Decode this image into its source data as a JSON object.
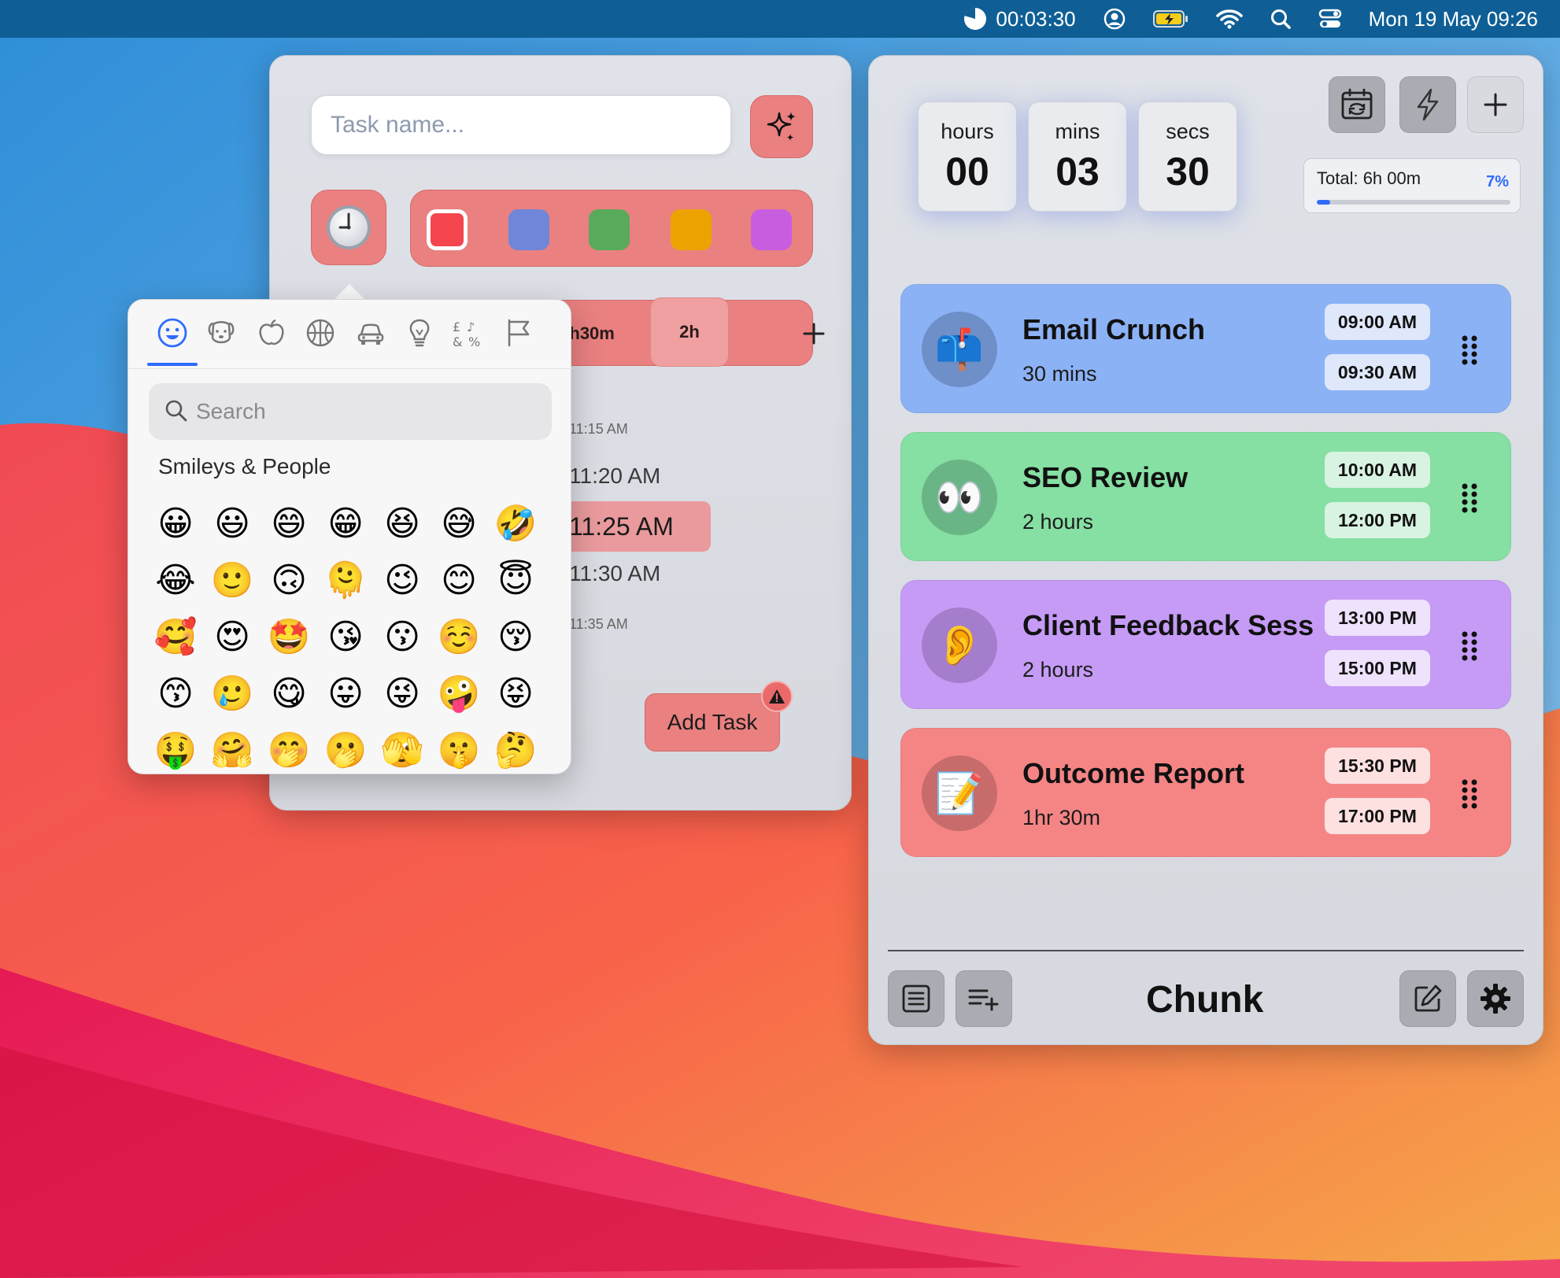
{
  "menubar": {
    "timer": "00:03:30",
    "datetime": "Mon 19 May  09:26",
    "icons": [
      "pie-timer-icon",
      "user-circle-icon",
      "battery-charging-icon",
      "wifi-icon",
      "spotlight-search-icon",
      "control-center-icon"
    ]
  },
  "task_form": {
    "task_name_placeholder": "Task name...",
    "colors": [
      {
        "hex": "#f4444e",
        "selected": true
      },
      {
        "hex": "#6f86d9",
        "selected": false
      },
      {
        "hex": "#5aaa5c",
        "selected": false
      },
      {
        "hex": "#eca300",
        "selected": false
      },
      {
        "hex": "#c75ee0",
        "selected": false
      }
    ],
    "durations": [
      "1h30m",
      "2h"
    ],
    "active_duration": "2h",
    "add_duration_label": "+",
    "times": [
      "11:15 AM",
      "11:20 AM",
      "11:25 AM",
      "11:30 AM",
      "11:35 AM"
    ],
    "selected_time": "11:25 AM",
    "add_task_label": "Add Task"
  },
  "emoji_picker": {
    "categories": [
      "smileys-icon",
      "animals-icon",
      "food-icon",
      "activity-icon",
      "travel-icon",
      "objects-icon",
      "symbols-icon",
      "flags-icon"
    ],
    "search_placeholder": "Search",
    "section_title": "Smileys & People",
    "emojis": [
      [
        "😀",
        "😃",
        "😄",
        "😁",
        "😆",
        "😅",
        "🤣"
      ],
      [
        "😂",
        "🙂",
        "🙃",
        "🫠",
        "😉",
        "😊",
        "😇"
      ],
      [
        "🥰",
        "😍",
        "🤩",
        "😘",
        "😗",
        "☺️",
        "😚"
      ],
      [
        "😙",
        "🥲",
        "😋",
        "😛",
        "😜",
        "🤪",
        "😝"
      ],
      [
        "🤑",
        "🤗",
        "🤭",
        "🫢",
        "🫣",
        "🤫",
        "🤔"
      ]
    ]
  },
  "timer": {
    "hours_label": "hours",
    "hours": "00",
    "mins_label": "mins",
    "mins": "03",
    "secs_label": "secs",
    "secs": "30"
  },
  "total": {
    "label": "Total: 6h 00m",
    "percent_label": "7%",
    "progress": 0.07
  },
  "tasks": [
    {
      "emoji": "📫",
      "name": "Email Crunch",
      "duration": "30 mins",
      "start": "09:00 AM",
      "end": "09:30 AM",
      "color": "#8cb2f6",
      "pill": "#dfe7fa",
      "avatar_bg": "#6f8fc8"
    },
    {
      "emoji": "👀",
      "name": "SEO Review",
      "duration": "2 hours",
      "start": "10:00 AM",
      "end": "12:00 PM",
      "color": "#86dfa3",
      "pill": "#d8f3e1",
      "avatar_bg": "#6ab585"
    },
    {
      "emoji": "👂",
      "name": "Client Feedback Sess",
      "duration": "2 hours",
      "start": "13:00 PM",
      "end": "15:00 PM",
      "color": "#c59bf6",
      "pill": "#eee2fc",
      "avatar_bg": "#a47dcc"
    },
    {
      "emoji": "📝",
      "name": "Outcome Report",
      "duration": "1hr 30m",
      "start": "15:30 PM",
      "end": "17:00 PM",
      "color": "#f58585",
      "pill": "#fde1e1",
      "avatar_bg": "#c86b6b"
    }
  ],
  "app": {
    "title": "Chunk"
  }
}
